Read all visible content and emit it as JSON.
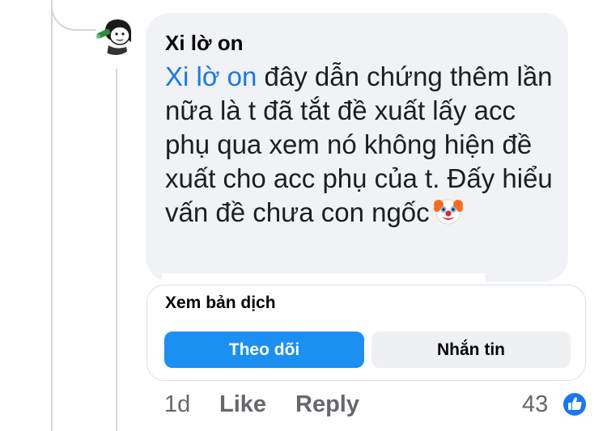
{
  "comment": {
    "author": "Xi lờ on",
    "mention": "Xi lờ on",
    "text": " đây dẫn chứng thêm lần nữa là t đã tắt đề xuất lấy acc phụ qua xem nó không hiện đề xuất cho acc phụ của t. Đấy hiểu vấn đề chưa con ngốc",
    "emoji": "clown-face-icon",
    "link_color": "#1877f2"
  },
  "card": {
    "translate_label": "Xem bản dịch",
    "follow_label": "Theo dõi",
    "message_label": "Nhắn tin",
    "follow_color": "#1b8ff2"
  },
  "actions": {
    "time": "1d",
    "like_label": "Like",
    "reply_label": "Reply",
    "reaction_count": "43",
    "reaction_icon": "thumbs-up-icon",
    "reaction_color": "#1877f2"
  }
}
